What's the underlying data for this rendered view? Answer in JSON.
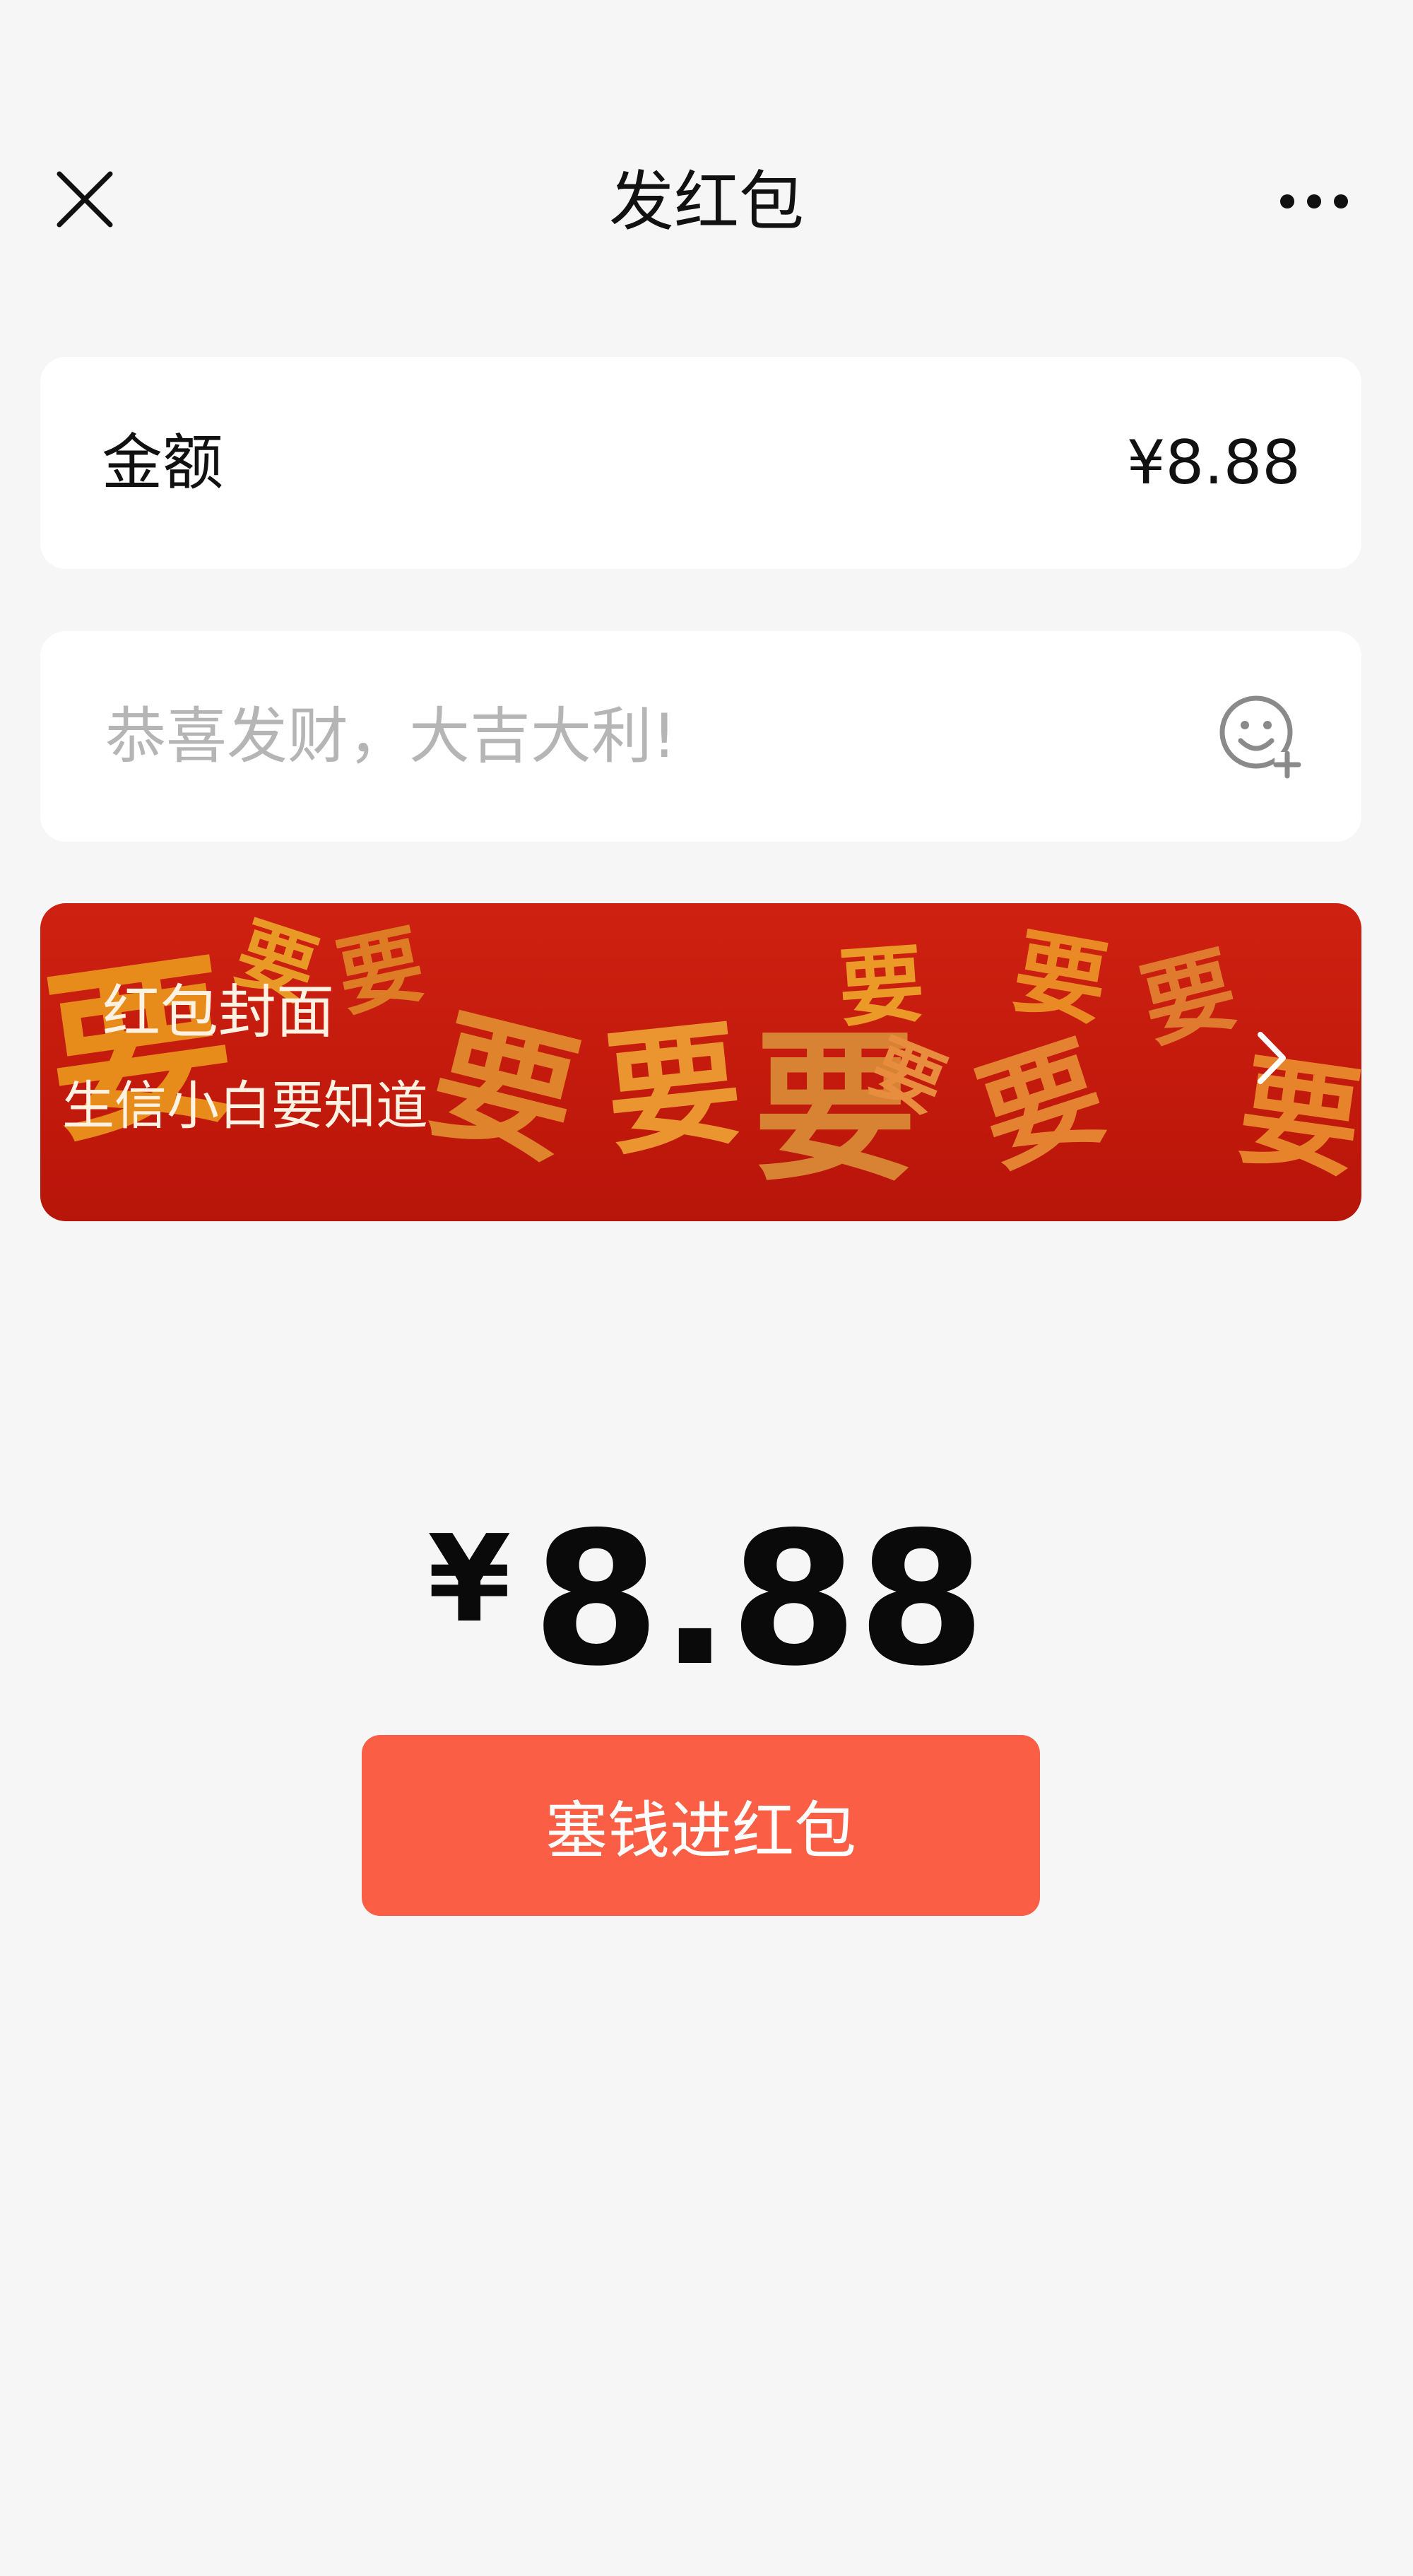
{
  "header": {
    "title": "发红包",
    "close_icon": "close-icon",
    "more_icon": "more-icon"
  },
  "amount": {
    "label": "金额",
    "value": "¥8.88"
  },
  "greeting": {
    "placeholder": "恭喜发财，大吉大利!",
    "value": "",
    "emoji_icon": "emoji-add-icon"
  },
  "cover": {
    "title": "红包封面",
    "subtitle": "生信小白要知道",
    "chevron_icon": "chevron-right-icon",
    "background_chars": [
      "要",
      "要",
      "要",
      "要",
      "要",
      "要",
      "要",
      "要",
      "要",
      "要",
      "要",
      "要"
    ]
  },
  "total": {
    "currency": "¥",
    "value": "8.88"
  },
  "submit": {
    "label": "塞钱进红包",
    "color": "#fa5f46"
  }
}
